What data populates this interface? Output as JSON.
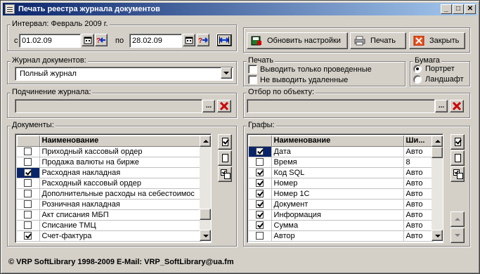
{
  "window": {
    "title": "Печать реестра журнала документов",
    "minimize": "_",
    "maximize": "□",
    "close": "✕"
  },
  "interval": {
    "label": "Интервал: Февраль 2009 г.",
    "from_label": "с",
    "from_value": "01.02.09",
    "to_label": "по",
    "to_value": "28.02.09"
  },
  "toolbar": {
    "refresh_label": "Обновить настройки",
    "print_label": "Печать",
    "close_label": "Закрыть"
  },
  "journal": {
    "label": "Журнал документов:",
    "value": "Полный журнал"
  },
  "print_opts": {
    "label": "Печать",
    "only_posted": "Выводить только проведенные",
    "no_deleted": "Не выводить удаленные"
  },
  "paper": {
    "label": "Бумага",
    "portrait": "Портрет",
    "landscape": "Ландшафт"
  },
  "subordination": {
    "label": "Подчинение журнала:",
    "value": ""
  },
  "object_filter": {
    "label": "Отбор по объекту:",
    "value": ""
  },
  "documents": {
    "label": "Документы:",
    "col_name": "Наименование",
    "rows": [
      {
        "name": "Приходный кассовый ордер",
        "checked": false
      },
      {
        "name": "Продажа валюты на бирже",
        "checked": false
      },
      {
        "name": "Расходная накладная",
        "checked": true
      },
      {
        "name": "Расходный кассовый ордер",
        "checked": false
      },
      {
        "name": "Дополнительные расходы на себестоимос",
        "checked": false
      },
      {
        "name": "Розничная накладная",
        "checked": false
      },
      {
        "name": "Акт списания МБП",
        "checked": false
      },
      {
        "name": "Списание ТМЦ",
        "checked": false
      },
      {
        "name": "Счет-фактура",
        "checked": true
      }
    ]
  },
  "columns": {
    "label": "Графы:",
    "col_name": "Наименование",
    "col_width": "Ши...",
    "rows": [
      {
        "name": "Дата",
        "width": "Авто",
        "checked": true
      },
      {
        "name": "Время",
        "width": "8",
        "checked": false
      },
      {
        "name": "Код SQL",
        "width": "Авто",
        "checked": true
      },
      {
        "name": "Номер",
        "width": "Авто",
        "checked": true
      },
      {
        "name": "Номер 1С",
        "width": "Авто",
        "checked": true
      },
      {
        "name": "Документ",
        "width": "Авто",
        "checked": true
      },
      {
        "name": "Информация",
        "width": "Авто",
        "checked": true
      },
      {
        "name": "Сумма",
        "width": "Авто",
        "checked": true
      },
      {
        "name": "Автор",
        "width": "Авто",
        "checked": false
      }
    ]
  },
  "footer": {
    "text": "© VRP SoftLibrary 1998-2009 E-Mail: VRP_SoftLibrary@ua.fm"
  },
  "colors": {
    "title_start": "#0a246a",
    "title_end": "#a6caf0",
    "face": "#d4d0c8",
    "delete_red": "#cc0000"
  }
}
